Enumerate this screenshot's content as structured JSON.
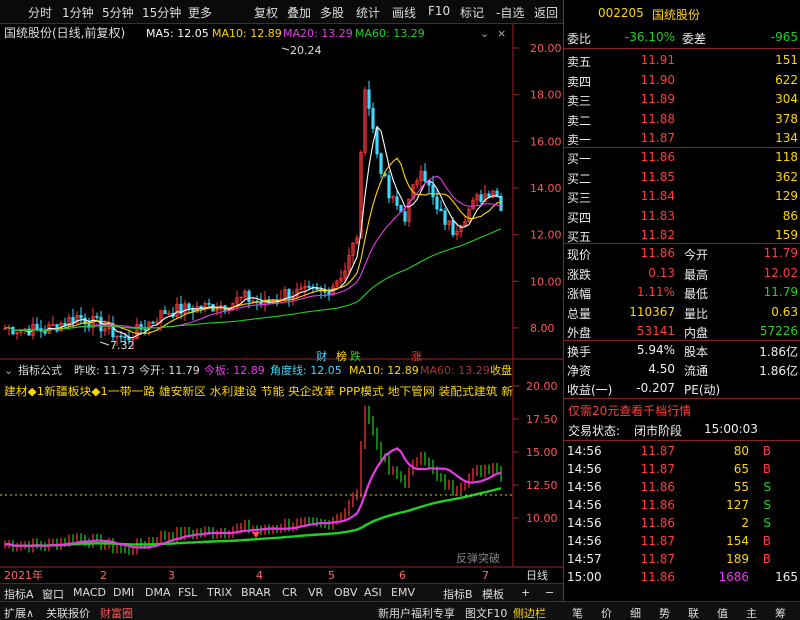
{
  "toolbar": {
    "period_tabs": [
      "分时",
      "1分钟",
      "5分钟",
      "15分钟",
      "更多"
    ],
    "right_tabs": [
      "复权",
      "叠加",
      "多股",
      "统计",
      "画线",
      "F10",
      "标记",
      "-自选",
      "返回"
    ]
  },
  "kline": {
    "title": "国统股份(日线,前复权)",
    "ma5": "MA5: 12.05",
    "ma10": "MA10: 12.89",
    "ma20": "MA20: 13.29",
    "ma60": "MA60: 13.29",
    "peak_label": "20.24",
    "low_label": "7.32",
    "y_ticks": [
      "20.00",
      "18.00",
      "16.00",
      "14.00",
      "12.00",
      "10.00",
      "8.00"
    ],
    "markers": [
      "财",
      "榜",
      "跌",
      "涨"
    ]
  },
  "indicator": {
    "name": "指标公式",
    "prev_close": "昨收: 11.73",
    "open": "今开: 11.79",
    "limit": "今板: 12.89",
    "angle": "角度线: 12.05",
    "ma10": "MA10: 12.89",
    "ma60": "MA60: 13.29",
    "close": "收盘",
    "concepts": "建材◆1新疆板块◆1一带一路 雄安新区 水利建设 节能 央企改革 PPP模式 地下管网 装配式建筑 新",
    "y_ticks": [
      "20.00",
      "17.50",
      "15.00",
      "12.50",
      "10.00"
    ],
    "signal": "反弹突破"
  },
  "date_axis": {
    "labels": [
      "2021年",
      "2",
      "3",
      "4",
      "5",
      "6",
      "7"
    ],
    "period": "日线"
  },
  "bottom_tabs": [
    "指标A",
    "窗口",
    "MACD",
    "DMI",
    "DMA",
    "FSL",
    "TRIX",
    "BRAR",
    "CR",
    "VR",
    "OBV",
    "ASI",
    "EMV",
    "指标B",
    "模板"
  ],
  "status_left": [
    "扩展∧",
    "关联报价",
    "财富圈"
  ],
  "status_mid": [
    "新用户福利专享",
    "图文F10",
    "侧边栏"
  ],
  "status_right": [
    "笔",
    "价",
    "细",
    "势",
    "联",
    "值",
    "主",
    "筹"
  ],
  "quote": {
    "code": "002205",
    "name": "国统股份",
    "weibi_label": "委比",
    "weibi": "-36.10%",
    "weicha_label": "委差",
    "weicha": "-965",
    "asks": [
      {
        "label": "卖五",
        "price": "11.91",
        "vol": "151"
      },
      {
        "label": "卖四",
        "price": "11.90",
        "vol": "622"
      },
      {
        "label": "卖三",
        "price": "11.89",
        "vol": "304"
      },
      {
        "label": "卖二",
        "price": "11.88",
        "vol": "378"
      },
      {
        "label": "卖一",
        "price": "11.87",
        "vol": "134"
      }
    ],
    "bids": [
      {
        "label": "买一",
        "price": "11.86",
        "vol": "118"
      },
      {
        "label": "买二",
        "price": "11.85",
        "vol": "362"
      },
      {
        "label": "买三",
        "price": "11.84",
        "vol": "129"
      },
      {
        "label": "买四",
        "price": "11.83",
        "vol": "86"
      },
      {
        "label": "买五",
        "price": "11.82",
        "vol": "159"
      }
    ],
    "stats": [
      {
        "l1": "现价",
        "v1": "11.86",
        "l2": "今开",
        "v2": "11.79"
      },
      {
        "l1": "涨跌",
        "v1": "0.13",
        "l2": "最高",
        "v2": "12.02"
      },
      {
        "l1": "涨幅",
        "v1": "1.11%",
        "l2": "最低",
        "v2": "11.79"
      },
      {
        "l1": "总量",
        "v1": "110367",
        "l2": "量比",
        "v2": "0.63"
      },
      {
        "l1": "外盘",
        "v1": "53141",
        "l2": "内盘",
        "v2": "57226"
      }
    ],
    "stats2": [
      {
        "l1": "换手",
        "v1": "5.94%",
        "l2": "股本",
        "v2": "1.86亿"
      },
      {
        "l1": "净资",
        "v1": "4.50",
        "l2": "流通",
        "v2": "1.86亿"
      },
      {
        "l1": "收益(一)",
        "v1": "-0.207",
        "l2": "PE(动)",
        "v2": ""
      }
    ],
    "promo": "仅需20元查看千档行情",
    "trade_state_label": "交易状态:",
    "trade_state": "闭市阶段",
    "trade_time": "15:00:03",
    "ticks": [
      {
        "t": "14:56",
        "p": "11.87",
        "v": "80",
        "s": "B"
      },
      {
        "t": "14:56",
        "p": "11.87",
        "v": "65",
        "s": "B"
      },
      {
        "t": "14:56",
        "p": "11.86",
        "v": "55",
        "s": "S"
      },
      {
        "t": "14:56",
        "p": "11.86",
        "v": "127",
        "s": "S"
      },
      {
        "t": "14:56",
        "p": "11.86",
        "v": "2",
        "s": "S"
      },
      {
        "t": "14:56",
        "p": "11.87",
        "v": "154",
        "s": "B"
      },
      {
        "t": "14:57",
        "p": "11.87",
        "v": "189",
        "b2": "B",
        "s": "B"
      },
      {
        "t": "15:00",
        "p": "11.86",
        "v": "1686",
        "s": "165"
      }
    ]
  },
  "colors": {
    "up": "#ff3b3b",
    "down": "#1fd11f",
    "ma5": "#ffffff",
    "ma10": "#ffd700",
    "ma20": "#e838e8",
    "ma60": "#1fd11f"
  }
}
